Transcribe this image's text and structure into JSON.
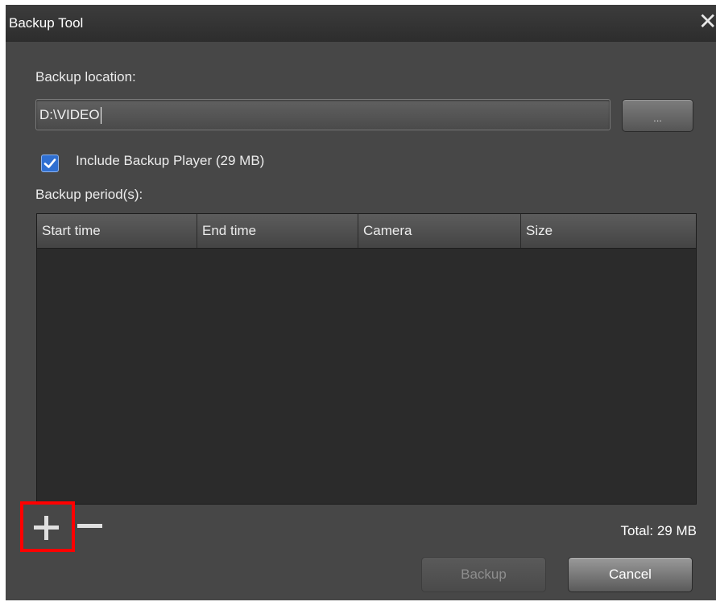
{
  "window": {
    "title": "Backup Tool",
    "close_icon": "close-icon"
  },
  "location": {
    "label": "Backup location:",
    "value": "D:\\VIDEO",
    "browse_label": "..."
  },
  "player": {
    "label": "Include Backup Player (29 MB)",
    "checked": true
  },
  "periods": {
    "label": "Backup period(s):",
    "columns": [
      "Start time",
      "End time",
      "Camera",
      "Size"
    ],
    "rows": []
  },
  "controls": {
    "add_icon": "plus-icon",
    "remove_icon": "minus-icon"
  },
  "total": "Total: 29 MB",
  "buttons": {
    "backup": "Backup",
    "cancel": "Cancel"
  },
  "colors": {
    "highlight": "#ff0000",
    "checkbox": "#2f6fd1",
    "background": "#474747"
  }
}
